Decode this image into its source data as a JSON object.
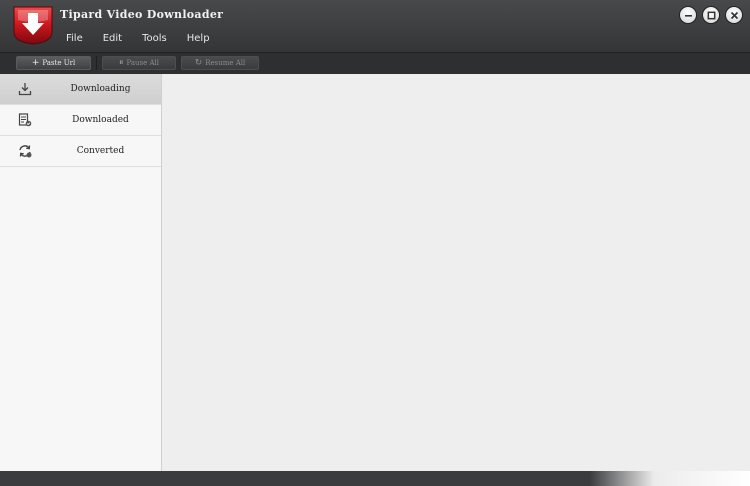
{
  "app": {
    "title": "Tipard Video Downloader"
  },
  "menu": {
    "items": [
      "File",
      "Edit",
      "Tools",
      "Help"
    ]
  },
  "window_controls": [
    "minimize-icon",
    "maximize-icon",
    "close-icon"
  ],
  "toolbar": {
    "paste_url": "Paste Url",
    "pause_all": "Pause All",
    "resume_all": "Resume All"
  },
  "sidebar": {
    "items": [
      {
        "label": "Downloading",
        "icon": "download-icon",
        "active": true
      },
      {
        "label": "Downloaded",
        "icon": "downloaded-list-icon",
        "active": false
      },
      {
        "label": "Converted",
        "icon": "convert-icon",
        "active": false
      }
    ]
  },
  "colors": {
    "title_bar": "#3d3e40",
    "logo_red": "#c8161d",
    "content_bg": "#eeeeee",
    "sidebar_bg": "#f7f7f7"
  }
}
